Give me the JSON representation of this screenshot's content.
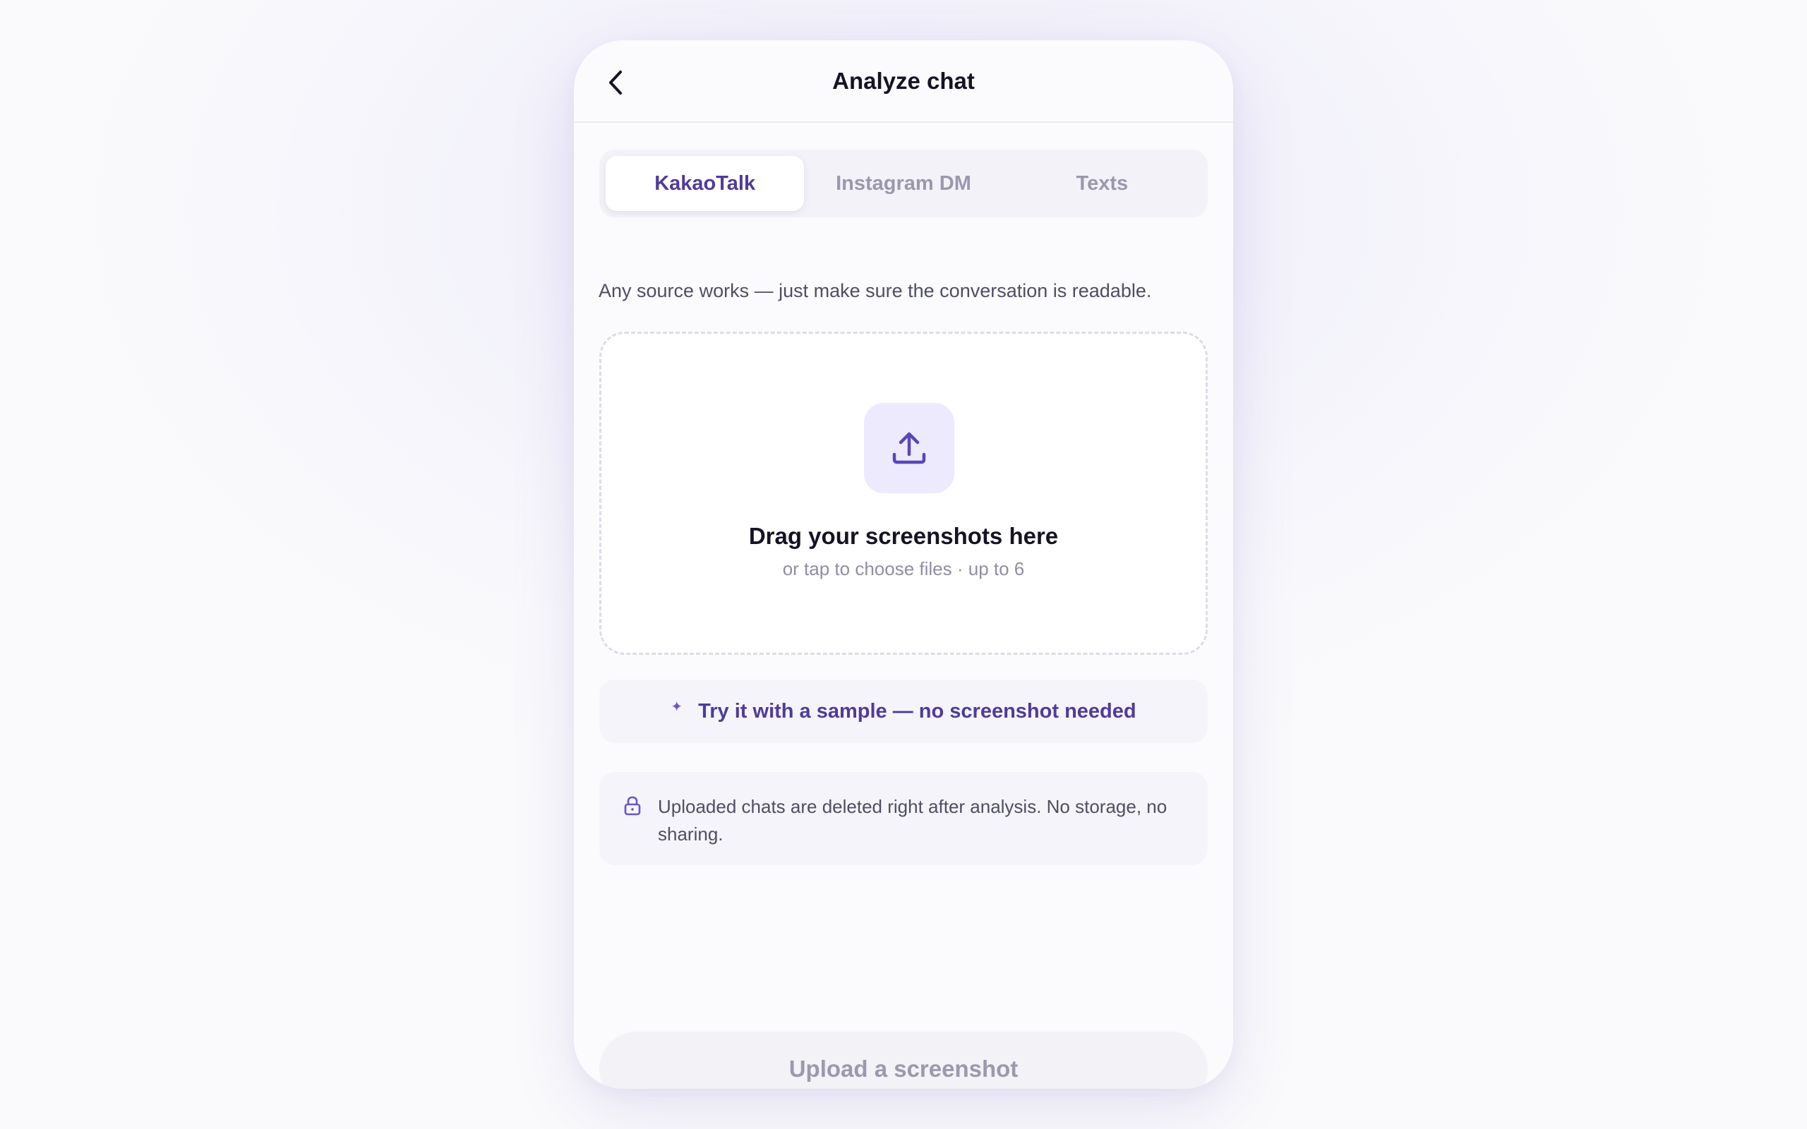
{
  "header": {
    "title": "Analyze chat",
    "back_icon": "chevron-left-icon"
  },
  "tabs": [
    {
      "label": "KakaoTalk",
      "active": true
    },
    {
      "label": "Instagram DM",
      "active": false
    },
    {
      "label": "Texts",
      "active": false
    }
  ],
  "hint": "Any source works — just make sure the conversation is readable.",
  "dropzone": {
    "icon": "upload-icon",
    "title": "Drag your screenshots here",
    "subtitle": "or tap to choose files · up to 6"
  },
  "sample": {
    "icon": "sparkle-icon",
    "label": "Try it with a sample — no screenshot needed"
  },
  "privacy": {
    "icon": "lock-icon",
    "text": "Uploaded chats are deleted right after analysis. No storage, no sharing."
  },
  "cta": {
    "label": "Upload a screenshot",
    "enabled": false
  },
  "colors": {
    "accent": "#4e3c99",
    "accent_light": "#eceafc",
    "text_primary": "#151424",
    "text_muted": "#8f8da2"
  }
}
